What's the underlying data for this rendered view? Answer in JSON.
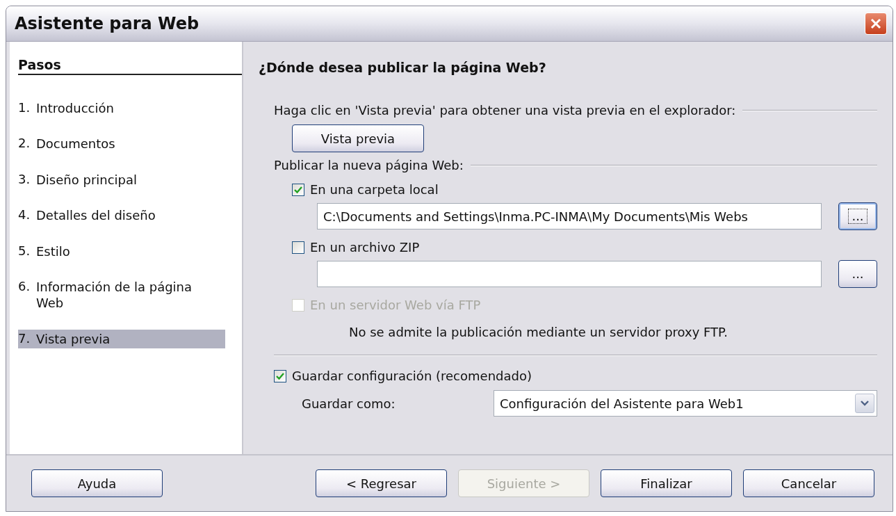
{
  "window": {
    "title": "Asistente para Web"
  },
  "sidebar": {
    "heading": "Pasos",
    "steps": [
      {
        "number": "1.",
        "label": "Introducción",
        "selected": false
      },
      {
        "number": "2.",
        "label": "Documentos",
        "selected": false
      },
      {
        "number": "3.",
        "label": "Diseño principal",
        "selected": false
      },
      {
        "number": "4.",
        "label": "Detalles del diseño",
        "selected": false
      },
      {
        "number": "5.",
        "label": "Estilo",
        "selected": false
      },
      {
        "number": "6.",
        "label": "Información de la página Web",
        "selected": false
      },
      {
        "number": "7.",
        "label": "Vista previa",
        "selected": true
      }
    ]
  },
  "page": {
    "heading": "¿Dónde desea publicar la página Web?",
    "preview_section": {
      "label": "Haga clic en 'Vista previa' para obtener una vista previa en el explorador:",
      "button": "Vista previa"
    },
    "publish_section": {
      "label": "Publicar la nueva página Web:",
      "options": [
        {
          "kind": "path",
          "label": "En una carpeta local",
          "checked": true,
          "disabled": false,
          "value": "C:\\Documents and Settings\\Inma.PC-INMA\\My Documents\\Mis Webs",
          "browse": "...",
          "focused": true
        },
        {
          "kind": "path",
          "label": "En un archivo ZIP",
          "checked": false,
          "disabled": false,
          "browse": "...",
          "focused": false
        },
        {
          "kind": "note",
          "label": "En un servidor Web vía FTP",
          "checked": false,
          "disabled": true,
          "note": "No se admite la publicación mediante un servidor proxy FTP."
        }
      ]
    },
    "save": {
      "label": "Guardar configuración (recomendado)",
      "checked": true,
      "name_label": "Guardar como:",
      "name_value": "Configuración del Asistente para Web1"
    }
  },
  "buttons": [
    {
      "label": "Ayuda",
      "disabled": false
    },
    {
      "label": "< Regresar",
      "disabled": false
    },
    {
      "label": "Siguiente >",
      "disabled": true
    },
    {
      "label": "Finalizar",
      "disabled": false
    },
    {
      "label": "Cancelar",
      "disabled": false
    }
  ]
}
